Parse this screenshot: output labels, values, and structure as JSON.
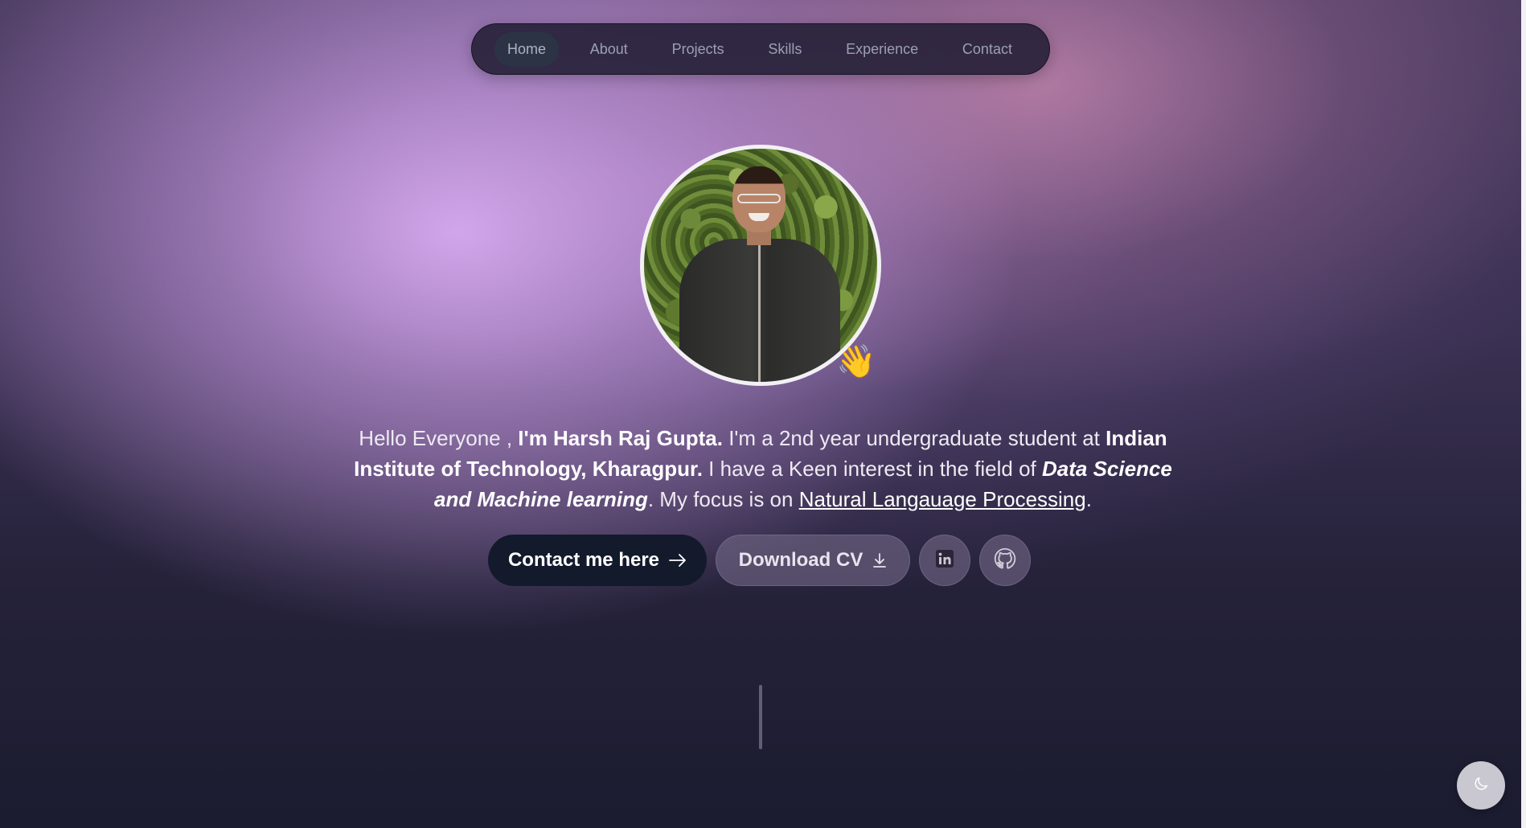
{
  "nav": {
    "items": [
      {
        "label": "Home",
        "active": true
      },
      {
        "label": "About",
        "active": false
      },
      {
        "label": "Projects",
        "active": false
      },
      {
        "label": "Skills",
        "active": false
      },
      {
        "label": "Experience",
        "active": false
      },
      {
        "label": "Contact",
        "active": false
      }
    ]
  },
  "hero": {
    "avatar_icon": "profile-photo",
    "wave_emoji": "👋",
    "intro": {
      "greeting": "Hello Everyone , ",
      "name": "I'm Harsh Raj Gupta.",
      "part2": " I'm a 2nd year undergraduate student at ",
      "institute": "Indian Institute of Technology, Kharagpur.",
      "part3": " I have a Keen interest in the field of ",
      "field": "Data Science and Machine learning",
      "part4": ". My focus is on ",
      "focus": "Natural Langauage Processing",
      "end": "."
    }
  },
  "actions": {
    "contact_label": "Contact me here",
    "contact_icon": "arrow-right-icon",
    "cv_label": "Download CV",
    "cv_icon": "download-icon",
    "linkedin_icon": "linkedin-icon",
    "github_icon": "github-icon"
  },
  "theme_toggle": {
    "icon": "moon-icon"
  },
  "colors": {
    "nav_bg": "#221e34",
    "nav_active_bg": "#2b3344",
    "primary_button": "#131a2b",
    "secondary_button": "#6e6482"
  }
}
